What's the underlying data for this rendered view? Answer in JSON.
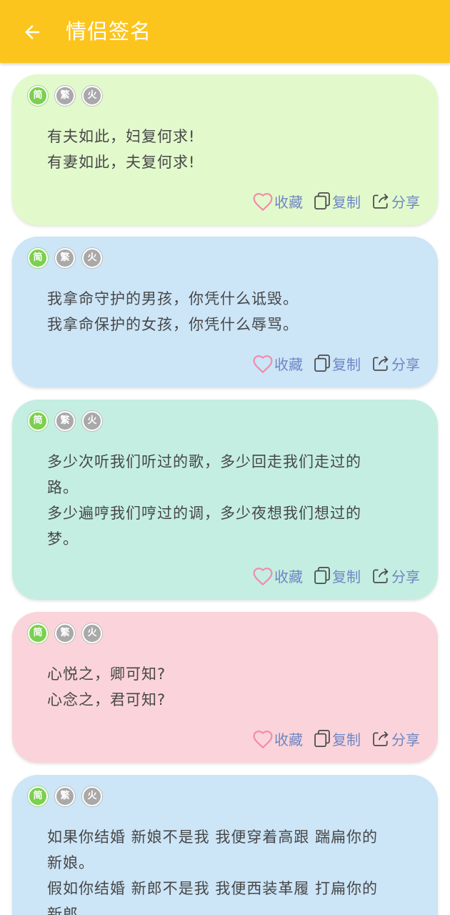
{
  "appbar": {
    "title": "情侣签名",
    "back_icon": "arrow-left-icon"
  },
  "colors": {
    "appbar": "#fcc51d",
    "card_green": "#e2f9cc",
    "card_blue": "#cce5f7",
    "card_mint": "#c4eee2",
    "card_pink": "#fad4da",
    "badge_active": "#7bd04f",
    "badge_inactive": "#a9a9a9",
    "action_text": "#6e86c3",
    "heart": "#f28aa8"
  },
  "badges": {
    "simplified": "简",
    "traditional": "繁",
    "martian": "火"
  },
  "actions": {
    "favorite": "收藏",
    "copy": "复制",
    "share": "分享",
    "favorite_icon": "heart-icon",
    "copy_icon": "copy-icon",
    "share_icon": "share-icon"
  },
  "signatures": [
    {
      "text": "有夫如此，妇复何求!\n有妻如此，夫复何求!"
    },
    {
      "text": "我拿命守护的男孩，你凭什么诋毁。\n我拿命保护的女孩，你凭什么辱骂。"
    },
    {
      "text": "多少次听我们听过的歌，多少回走我们走过的\n路。\n多少遍哼我们哼过的调，多少夜想我们想过的\n梦。"
    },
    {
      "text": "心悦之，卿可知?\n心念之，君可知?"
    },
    {
      "text": "如果你结婚 新娘不是我 我便穿着高跟 踹扁你的\n新娘。\n假如你结婚 新郎不是我 我便西装革履 打扁你的\n新郎。"
    }
  ]
}
